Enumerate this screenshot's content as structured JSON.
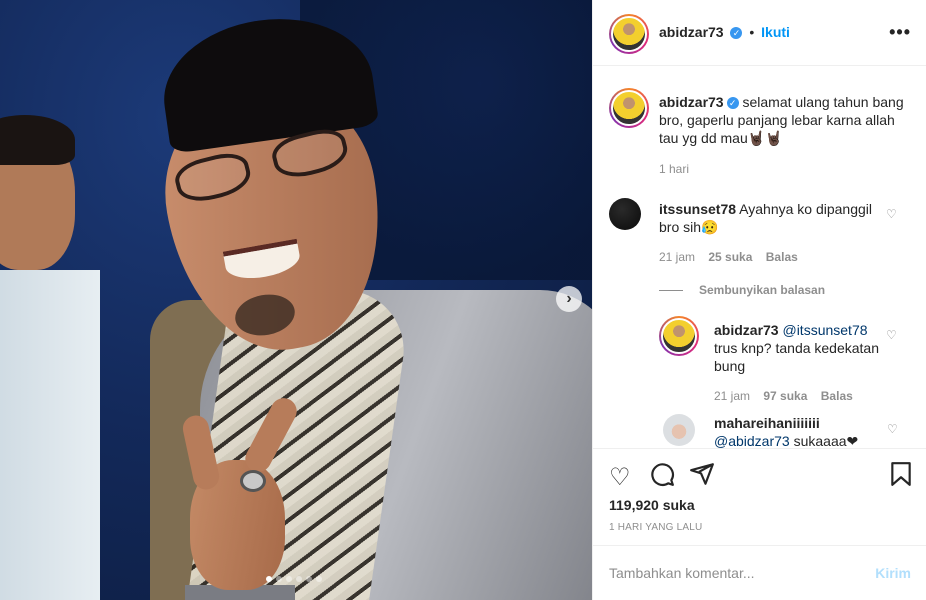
{
  "post": {
    "photo_alt": "Pria berpeci hitam berkacamata tersenyum",
    "carousel": {
      "slides": 6,
      "active": 0
    }
  },
  "header": {
    "username": "abidzar73",
    "separator": "•",
    "follow_label": "Ikuti",
    "more_label": "•••"
  },
  "caption": {
    "username": "abidzar73",
    "text": "selamat ulang tahun bang bro, gaperlu panjang lebar karna allah tau yg dd mau🤘🏿🤘🏿",
    "time": "1 hari"
  },
  "comments": [
    {
      "username": "itssunset78",
      "text": "Ayahnya ko dipanggil bro sih😥",
      "time": "21 jam",
      "likes": "25 suka",
      "reply_label": "Balas"
    }
  ],
  "hide_replies_label": "Sembunyikan balasan",
  "replies": [
    {
      "username": "abidzar73",
      "mention": "@itssunset78",
      "text": "trus knp? tanda kedekatan bung",
      "time": "21 jam",
      "likes": "97 suka",
      "reply_label": "Balas"
    },
    {
      "username": "mahareihaniiiiiii",
      "mention": "@abidzar73",
      "text": "sukaaaa❤"
    }
  ],
  "likes_count": "119,920 suka",
  "posted_ago": "1 HARI YANG LALU",
  "comment_input": {
    "placeholder": "Tambahkan komentar...",
    "send_label": "Kirim"
  },
  "colors": {
    "accent": "#0095f6",
    "text": "#262626",
    "muted": "#8e8e8e",
    "verified": "#3897f0"
  }
}
